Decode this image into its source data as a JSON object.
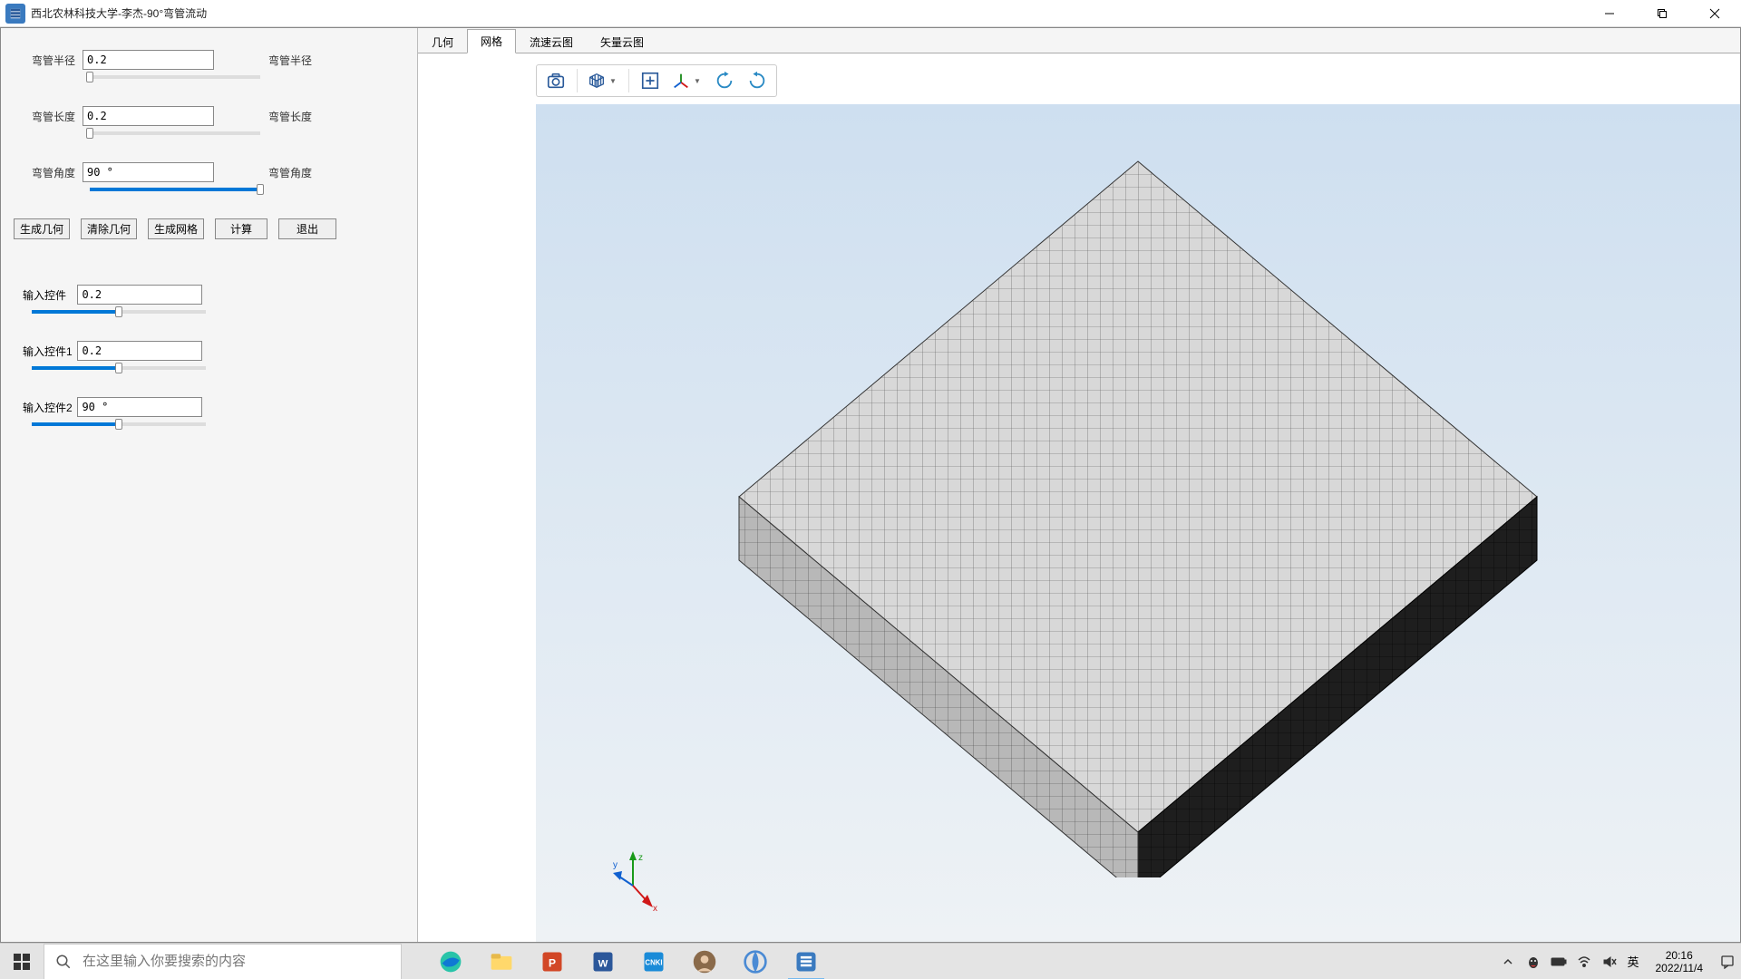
{
  "titlebar": {
    "title": "西北农林科技大学-李杰-90°弯管流动"
  },
  "sidebar": {
    "params": [
      {
        "label": "弯管半径",
        "value": "0.2",
        "right": "弯管半径",
        "pct": 0
      },
      {
        "label": "弯管长度",
        "value": "0.2",
        "right": "弯管长度",
        "pct": 0
      },
      {
        "label": "弯管角度",
        "value": "90 °",
        "right": "弯管角度",
        "pct": 100
      }
    ],
    "buttons": {
      "gen_geom": "生成几何",
      "clear_geom": "清除几何",
      "gen_mesh": "生成网格",
      "compute": "计算",
      "exit": "退出"
    },
    "secondary": [
      {
        "label": "输入控件",
        "value": "0.2",
        "pct": 50
      },
      {
        "label": "输入控件1",
        "value": "0.2",
        "pct": 50
      },
      {
        "label": "输入控件2",
        "value": "90 °",
        "pct": 50
      }
    ]
  },
  "tabs": {
    "items": [
      "几何",
      "网格",
      "流速云图",
      "矢量云图"
    ],
    "active_index": 1
  },
  "toolbar_icons": [
    "camera-icon",
    "mesh-grid-icon",
    "fit-view-icon",
    "axis-orient-icon",
    "rotate-left-icon",
    "rotate-right-icon"
  ],
  "search": {
    "placeholder": "在这里输入你要搜索的内容"
  },
  "tray": {
    "ime": "英",
    "time": "20:16",
    "date": "2022/11/4"
  }
}
